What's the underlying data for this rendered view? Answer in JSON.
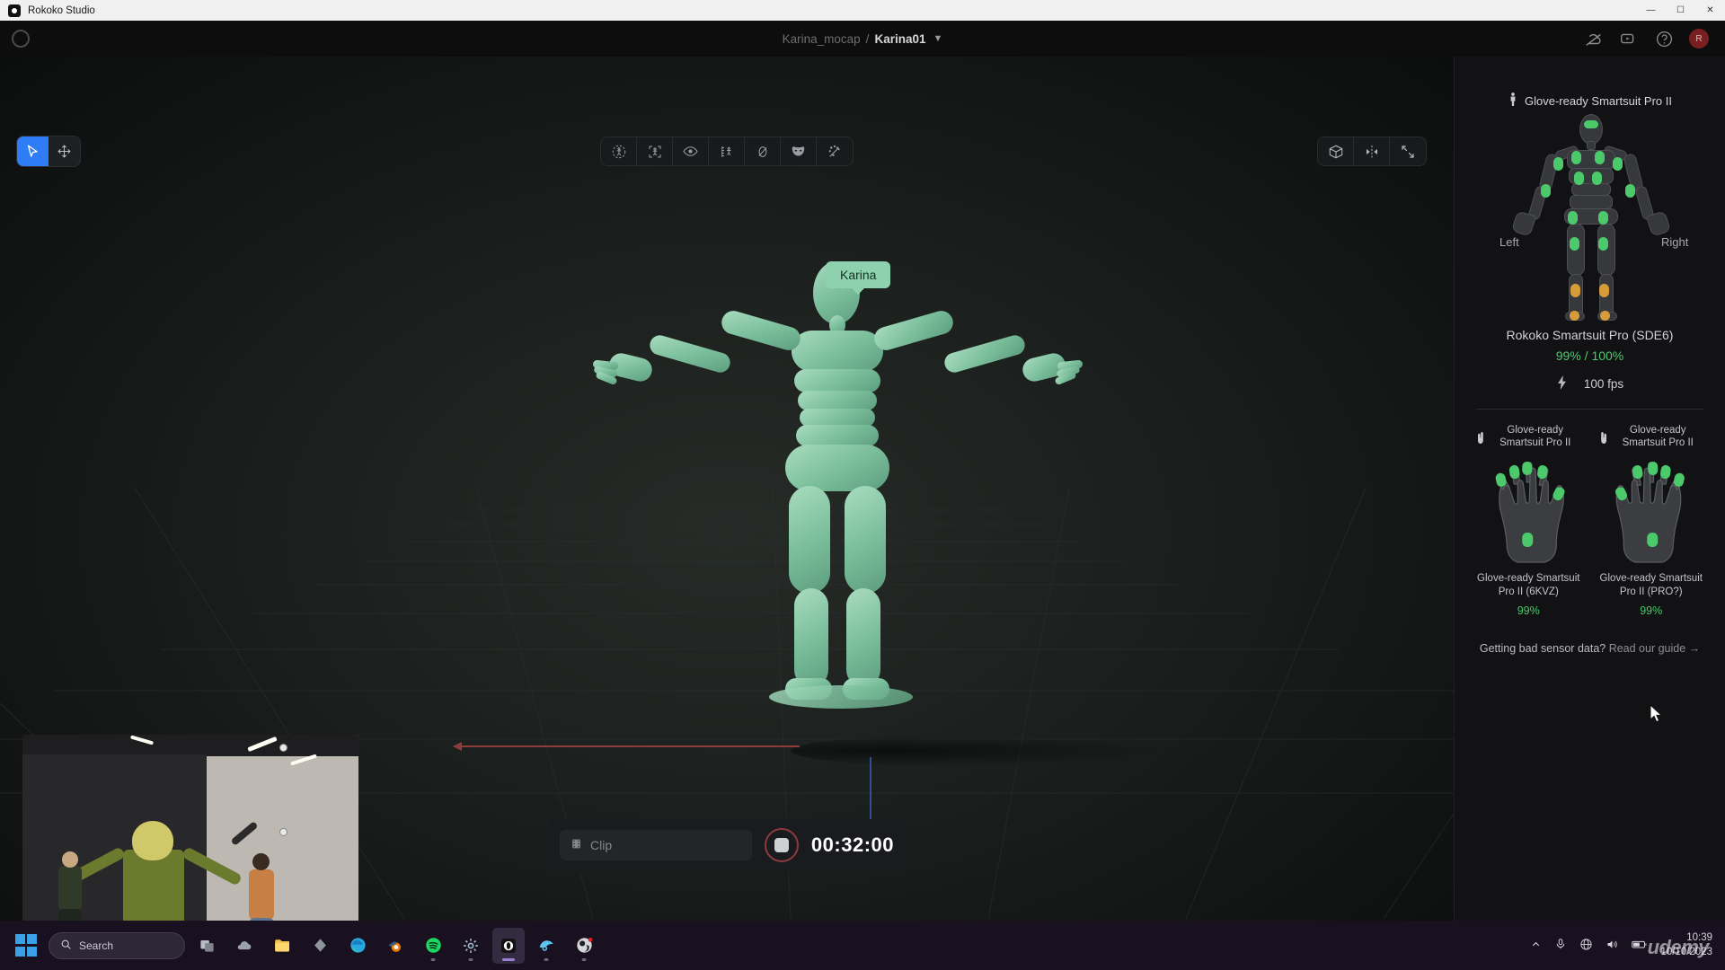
{
  "os": {
    "window_title": "Rokoko Studio",
    "app_icon": "rokoko-logo-icon",
    "minimize": "—",
    "maximize": "☐",
    "close": "✕"
  },
  "header": {
    "logo_icon": "rokoko-circle-icon",
    "breadcrumb": {
      "parent": "Karina_mocap",
      "separator": "/",
      "current": "Karina01",
      "chevron": "▼"
    },
    "right_icons": [
      {
        "name": "cloud-off-icon"
      },
      {
        "name": "video-record-icon"
      },
      {
        "name": "help-circle-icon"
      }
    ],
    "avatar_label": "R"
  },
  "toolbar_left": [
    {
      "name": "select-tool",
      "icon": "cursor-arrow-icon",
      "active": true
    },
    {
      "name": "move-tool",
      "icon": "move-arrows-icon",
      "active": false
    }
  ],
  "toolbar_center": [
    {
      "name": "character-tool",
      "icon": "person-circle-icon"
    },
    {
      "name": "frame-character-tool",
      "icon": "focus-person-icon"
    },
    {
      "name": "visibility-tool",
      "icon": "eye-icon"
    },
    {
      "name": "measure-tool",
      "icon": "person-ruler-icon"
    },
    {
      "name": "link-tool",
      "icon": "link-slash-icon"
    },
    {
      "name": "mask-tool",
      "icon": "mask-icon"
    },
    {
      "name": "magic-wand-tool",
      "icon": "magic-wand-icon"
    }
  ],
  "toolbar_right": [
    {
      "name": "cube-view-button",
      "icon": "cube-icon"
    },
    {
      "name": "mirror-view-button",
      "icon": "mirror-icon"
    },
    {
      "name": "fullscreen-button",
      "icon": "expand-arrows-icon"
    }
  ],
  "viewport": {
    "character_name_tag": "Karina",
    "axis_x_color": "#8e3b3b",
    "axis_z_color": "#2f4f8e",
    "character_color": "#79bd9a"
  },
  "clipbar": {
    "clip_icon": "film-strip-icon",
    "clip_placeholder": "Clip",
    "record_button": "stop-record-button",
    "timecode": "00:32:00"
  },
  "right_panel": {
    "suit_title": "Glove-ready Smartsuit Pro II",
    "suit_title_icon": "person-standing-icon",
    "left_label": "Left",
    "right_label": "Right",
    "device_name": "Rokoko Smartsuit Pro (SDE6)",
    "battery_pct": "99%",
    "signal_sep": "/",
    "signal_pct": "100%",
    "fps_icon": "lightning-bolt-icon",
    "fps": "100 fps",
    "gloves": [
      {
        "head_icon": "left-hand-icon",
        "head_label": "Glove-ready Smartsuit Pro II",
        "caption": "Glove-ready Smartsuit Pro II (6KVZ)",
        "pct": "99%"
      },
      {
        "head_icon": "right-hand-icon",
        "head_label": "Glove-ready Smartsuit Pro II",
        "caption": "Glove-ready Smartsuit Pro II (PRO?)",
        "pct": "99%"
      }
    ],
    "guide_question": "Getting bad sensor data?",
    "guide_link": "Read our guide →",
    "colors": {
      "ok": "#4bc96b",
      "warn": "#d79c3a"
    }
  },
  "taskbar": {
    "start_icon": "windows-start-icon",
    "search_icon": "search-icon",
    "search_placeholder": "Search",
    "apps": [
      {
        "name": "task-view-icon"
      },
      {
        "name": "weather-icon"
      },
      {
        "name": "file-explorer-icon"
      },
      {
        "name": "app-icon"
      },
      {
        "name": "edge-browser-icon"
      },
      {
        "name": "blender-icon"
      },
      {
        "name": "spotify-icon"
      },
      {
        "name": "settings-gear-icon"
      },
      {
        "name": "rokoko-studio-icon"
      },
      {
        "name": "steam-icon"
      },
      {
        "name": "obs-studio-icon"
      }
    ],
    "tray": [
      {
        "name": "show-hidden-icons-chevron"
      },
      {
        "name": "microphone-icon"
      },
      {
        "name": "network-icon"
      },
      {
        "name": "volume-icon"
      },
      {
        "name": "battery-icon"
      }
    ],
    "time": "10:39",
    "date": "10/10/2023",
    "watermark": "udemy"
  }
}
